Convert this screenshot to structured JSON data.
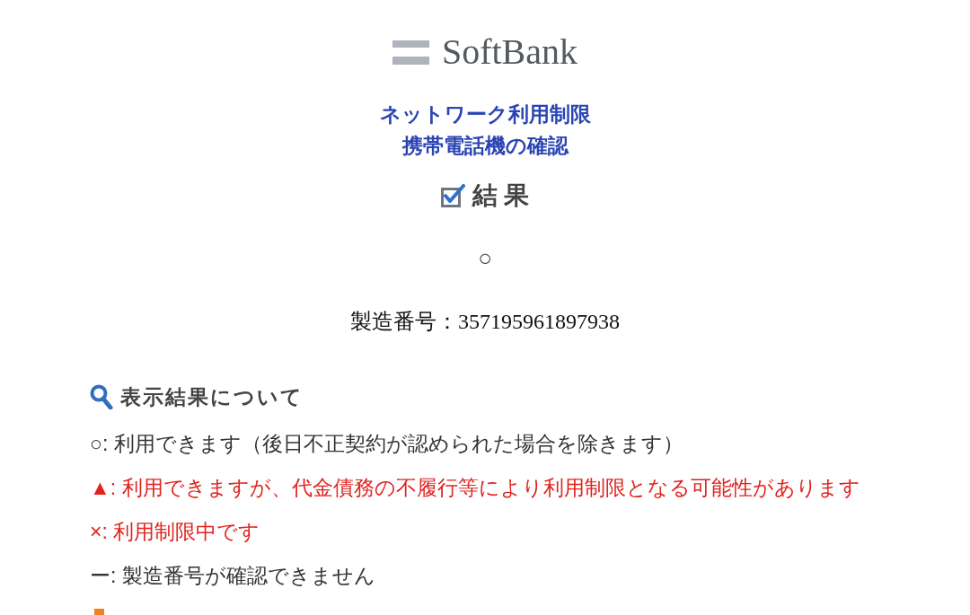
{
  "logo": {
    "text": "SoftBank"
  },
  "title_lines": [
    "ネットワーク利用制限",
    "携帯電話機の確認"
  ],
  "result_heading": "結 果",
  "result": "○",
  "serial": "製造番号：357195961897938",
  "legend": {
    "heading": "表示結果について",
    "items": [
      {
        "text": "○: 利用できます（後日不正契約が認められた場合を除きます）",
        "color": "#333333"
      },
      {
        "text": "▲: 利用できますが、代金債務の不履行等により利用制限となる可能性があります",
        "color": "#e0231e"
      },
      {
        "text": "×: 利用制限中です",
        "color": "#e0231e"
      },
      {
        "text": "ー: 製造番号が確認できません",
        "color": "#333333"
      }
    ]
  }
}
